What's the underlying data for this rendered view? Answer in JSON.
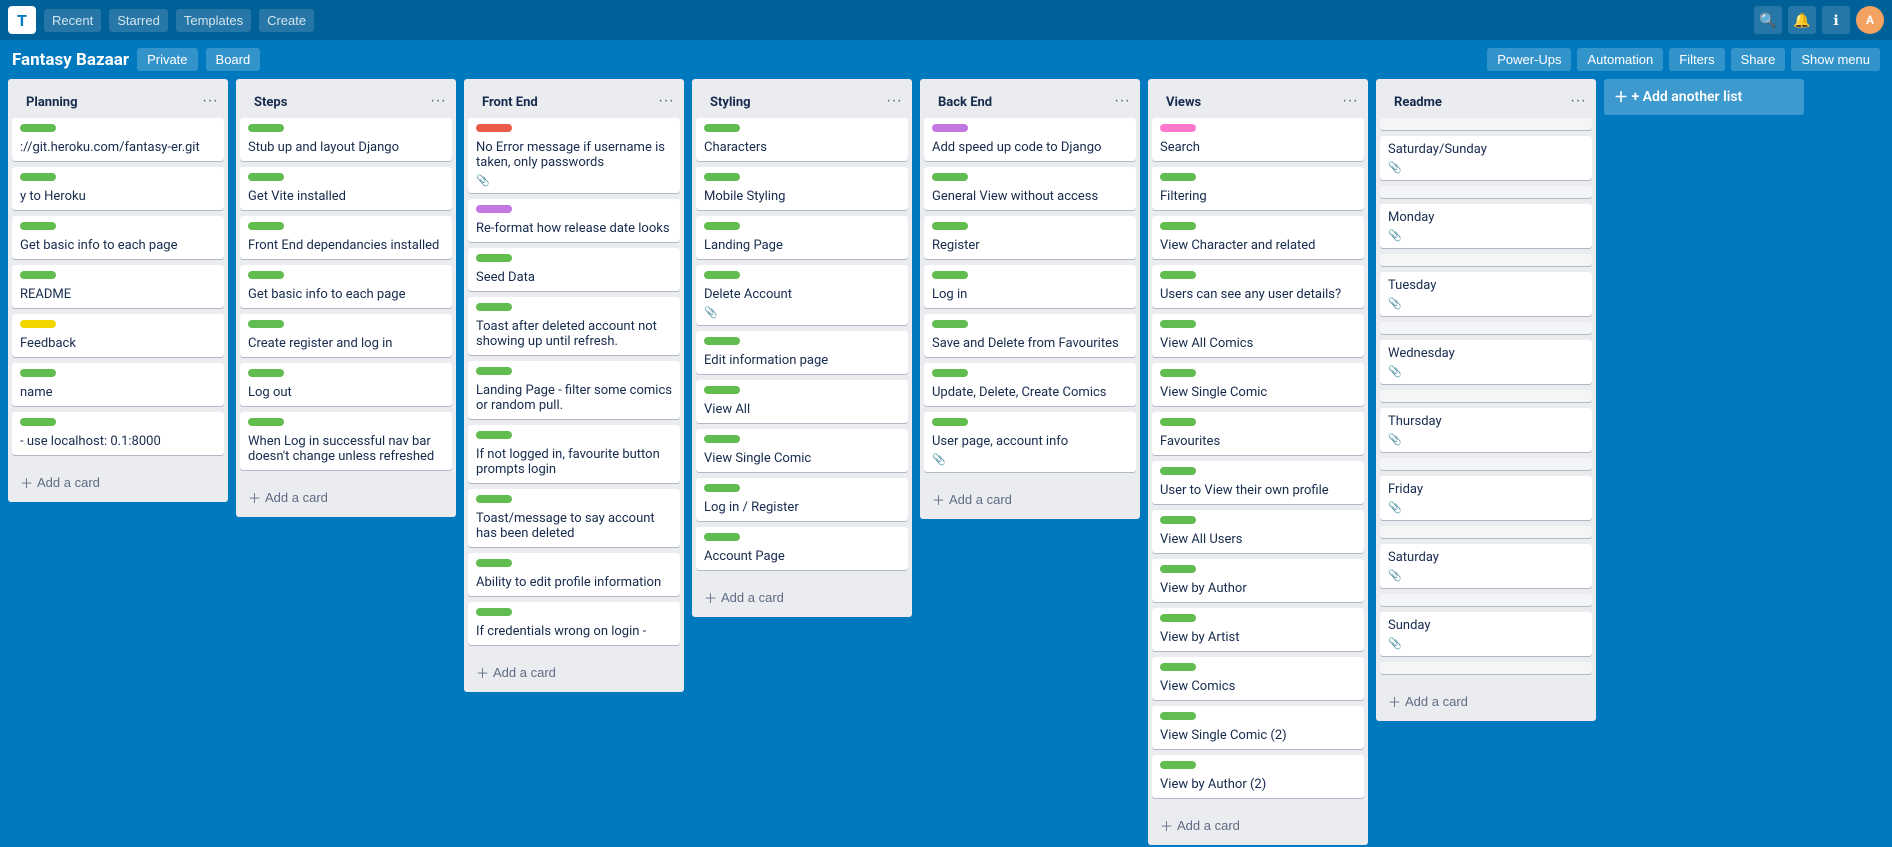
{
  "app": {
    "logo": "T",
    "board_title": "Fantasy Bazaar",
    "private_label": "Private",
    "board_btn": "Board",
    "customize_btn": "⋯",
    "power_ups_btn": "Power-Ups",
    "automation_btn": "Automation",
    "filters_btn": "Filters",
    "share_btn": "Share",
    "show_menu_btn": "Show menu"
  },
  "lists": [
    {
      "id": "planning",
      "title": "Planning",
      "cards": [
        {
          "id": "c1",
          "labels": [
            "green"
          ],
          "text": "://git.heroku.com/fantasy-er.git",
          "has_attachment": false
        },
        {
          "id": "c2",
          "labels": [
            "green"
          ],
          "text": "y to Heroku",
          "has_attachment": false
        },
        {
          "id": "c3",
          "labels": [
            "green"
          ],
          "text": "Get basic info to each page",
          "has_attachment": false
        },
        {
          "id": "c4",
          "labels": [
            "green"
          ],
          "text": "README",
          "has_attachment": false
        },
        {
          "id": "c5",
          "labels": [
            "yellow"
          ],
          "text": "Feedback",
          "has_attachment": false
        },
        {
          "id": "c6",
          "labels": [
            "green"
          ],
          "text": "name",
          "has_attachment": false
        },
        {
          "id": "c7",
          "labels": [
            "green"
          ],
          "text": "- use localhost:\n0.1:8000",
          "has_attachment": false
        }
      ],
      "add_label": "Add a card"
    },
    {
      "id": "steps",
      "title": "Steps",
      "cards": [
        {
          "id": "s1",
          "labels": [
            "green"
          ],
          "text": "Stub up and layout Django",
          "has_attachment": false
        },
        {
          "id": "s2",
          "labels": [
            "green"
          ],
          "text": "Get Vite installed",
          "has_attachment": false
        },
        {
          "id": "s3",
          "labels": [
            "green"
          ],
          "text": "Front End dependancies installed",
          "has_attachment": false
        },
        {
          "id": "s4",
          "labels": [
            "green"
          ],
          "text": "Get basic info to each page",
          "has_attachment": false
        },
        {
          "id": "s5",
          "labels": [
            "green"
          ],
          "text": "Create register and log in",
          "has_attachment": false
        },
        {
          "id": "s6",
          "labels": [
            "green"
          ],
          "text": "Log out",
          "has_attachment": false
        },
        {
          "id": "s7",
          "labels": [
            "green"
          ],
          "text": "When Log in successful nav bar doesn't change unless refreshed",
          "has_attachment": false
        }
      ],
      "add_label": "Add a card"
    },
    {
      "id": "front-end",
      "title": "Front End",
      "cards": [
        {
          "id": "fe1",
          "labels": [
            "red"
          ],
          "text": "No Error message if username is taken, only passwords",
          "has_attachment": true
        },
        {
          "id": "fe2",
          "labels": [
            "purple"
          ],
          "text": "Re-format how release date looks",
          "has_attachment": false
        },
        {
          "id": "fe3",
          "labels": [
            "green"
          ],
          "text": "Seed Data",
          "has_attachment": false
        },
        {
          "id": "fe4",
          "labels": [
            "green"
          ],
          "text": "Toast after deleted account not showing up until refresh.",
          "has_attachment": false
        },
        {
          "id": "fe5",
          "labels": [
            "green"
          ],
          "text": "Landing Page - filter some comics or random pull.",
          "has_attachment": false
        },
        {
          "id": "fe6",
          "labels": [
            "green"
          ],
          "text": "If not logged in, favourite button prompts login",
          "has_attachment": false
        },
        {
          "id": "fe7",
          "labels": [
            "green"
          ],
          "text": "Toast/message to say account has been deleted",
          "has_attachment": false
        },
        {
          "id": "fe8",
          "labels": [
            "green"
          ],
          "text": "Ability to edit profile information",
          "has_attachment": false
        },
        {
          "id": "fe9",
          "labels": [
            "green"
          ],
          "text": "If credentials wrong on login -",
          "has_attachment": false
        }
      ],
      "add_label": "Add a card"
    },
    {
      "id": "styling",
      "title": "Styling",
      "cards": [
        {
          "id": "st1",
          "labels": [
            "green"
          ],
          "text": "Characters",
          "has_attachment": false
        },
        {
          "id": "st2",
          "labels": [
            "green"
          ],
          "text": "Mobile Styling",
          "has_attachment": false
        },
        {
          "id": "st3",
          "labels": [
            "green"
          ],
          "text": "Landing Page",
          "has_attachment": false
        },
        {
          "id": "st4",
          "labels": [
            "green"
          ],
          "text": "Delete Account",
          "has_attachment": true
        },
        {
          "id": "st5",
          "labels": [
            "green"
          ],
          "text": "Edit information page",
          "has_attachment": false
        },
        {
          "id": "st6",
          "labels": [
            "green"
          ],
          "text": "View All",
          "has_attachment": false
        },
        {
          "id": "st7",
          "labels": [
            "green"
          ],
          "text": "View Single Comic",
          "has_attachment": false
        },
        {
          "id": "st8",
          "labels": [
            "green"
          ],
          "text": "Log in / Register",
          "has_attachment": false
        },
        {
          "id": "st9",
          "labels": [
            "green"
          ],
          "text": "Account Page",
          "has_attachment": false
        }
      ],
      "add_label": "Add a card"
    },
    {
      "id": "back-end",
      "title": "Back End",
      "cards": [
        {
          "id": "be1",
          "labels": [
            "purple"
          ],
          "text": "Add speed up code to Django",
          "has_attachment": false
        },
        {
          "id": "be2",
          "labels": [
            "green"
          ],
          "text": "General View without access",
          "has_attachment": false
        },
        {
          "id": "be3",
          "labels": [
            "green"
          ],
          "text": "Register",
          "has_attachment": false
        },
        {
          "id": "be4",
          "labels": [
            "green"
          ],
          "text": "Log in",
          "has_attachment": false
        },
        {
          "id": "be5",
          "labels": [
            "green"
          ],
          "text": "Save and Delete from Favourites",
          "has_attachment": false
        },
        {
          "id": "be6",
          "labels": [
            "green"
          ],
          "text": "Update, Delete, Create Comics",
          "has_attachment": false
        },
        {
          "id": "be7",
          "labels": [
            "green"
          ],
          "text": "User page, account info",
          "has_attachment": true
        }
      ],
      "add_label": "Add a card"
    },
    {
      "id": "views",
      "title": "Views",
      "cards": [
        {
          "id": "v1",
          "labels": [
            "pink"
          ],
          "text": "Search",
          "has_attachment": false
        },
        {
          "id": "v2",
          "labels": [
            "green"
          ],
          "text": "Filtering",
          "has_attachment": false
        },
        {
          "id": "v3",
          "labels": [
            "green"
          ],
          "text": "View Character and related",
          "has_attachment": false
        },
        {
          "id": "v4",
          "labels": [
            "green"
          ],
          "text": "Users can see any user details?",
          "has_attachment": false
        },
        {
          "id": "v5",
          "labels": [
            "green"
          ],
          "text": "View All Comics",
          "has_attachment": false
        },
        {
          "id": "v6",
          "labels": [
            "green"
          ],
          "text": "View Single Comic",
          "has_attachment": false
        },
        {
          "id": "v7",
          "labels": [
            "green"
          ],
          "text": "Favourites",
          "has_attachment": false
        },
        {
          "id": "v8",
          "labels": [
            "green"
          ],
          "text": "User to View their own profile",
          "has_attachment": false
        },
        {
          "id": "v9",
          "labels": [
            "green"
          ],
          "text": "View All Users",
          "has_attachment": false
        },
        {
          "id": "v10",
          "labels": [
            "green"
          ],
          "text": "View by Author",
          "has_attachment": false
        },
        {
          "id": "v11",
          "labels": [
            "green"
          ],
          "text": "View by Artist",
          "has_attachment": false
        },
        {
          "id": "v12",
          "labels": [
            "green"
          ],
          "text": "View Comics",
          "has_attachment": false
        },
        {
          "id": "v13",
          "labels": [
            "green"
          ],
          "text": "View Single Comic (2)",
          "has_attachment": false
        },
        {
          "id": "v14",
          "labels": [
            "green"
          ],
          "text": "View by Author (2)",
          "has_attachment": false
        }
      ],
      "add_label": "Add a card"
    },
    {
      "id": "readme",
      "title": "Readme",
      "cards": [
        {
          "id": "r1",
          "labels": [],
          "text": "",
          "has_attachment": false
        },
        {
          "id": "r2",
          "labels": [],
          "text": "Saturday/Sunday",
          "has_attachment": true
        },
        {
          "id": "r3",
          "labels": [],
          "text": "",
          "has_attachment": false
        },
        {
          "id": "r4",
          "labels": [],
          "text": "Monday",
          "has_attachment": true
        },
        {
          "id": "r5",
          "labels": [],
          "text": "",
          "has_attachment": false
        },
        {
          "id": "r6",
          "labels": [],
          "text": "Tuesday",
          "has_attachment": true
        },
        {
          "id": "r7",
          "labels": [],
          "text": "",
          "has_attachment": false
        },
        {
          "id": "r8",
          "labels": [],
          "text": "Wednesday",
          "has_attachment": true
        },
        {
          "id": "r9",
          "labels": [],
          "text": "",
          "has_attachment": false
        },
        {
          "id": "r10",
          "labels": [],
          "text": "Thursday",
          "has_attachment": true
        },
        {
          "id": "r11",
          "labels": [],
          "text": "",
          "has_attachment": false
        },
        {
          "id": "r12",
          "labels": [],
          "text": "Friday",
          "has_attachment": true
        },
        {
          "id": "r13",
          "labels": [],
          "text": "",
          "has_attachment": false
        },
        {
          "id": "r14",
          "labels": [],
          "text": "Saturday",
          "has_attachment": true
        },
        {
          "id": "r15",
          "labels": [],
          "text": "",
          "has_attachment": false
        },
        {
          "id": "r16",
          "labels": [],
          "text": "Sunday",
          "has_attachment": true
        },
        {
          "id": "r17",
          "labels": [],
          "text": "",
          "has_attachment": false
        }
      ],
      "add_label": "Add a card"
    }
  ],
  "label_colors": {
    "green": "#61bd4f",
    "yellow": "#f2d600",
    "orange": "#ff9f1a",
    "red": "#eb5a46",
    "purple": "#c377e0",
    "blue": "#0079bf",
    "pink": "#ff78cb",
    "light-green": "#51e898"
  },
  "add_card_label": "+ Add a card",
  "add_list_label": "+ Add another list"
}
